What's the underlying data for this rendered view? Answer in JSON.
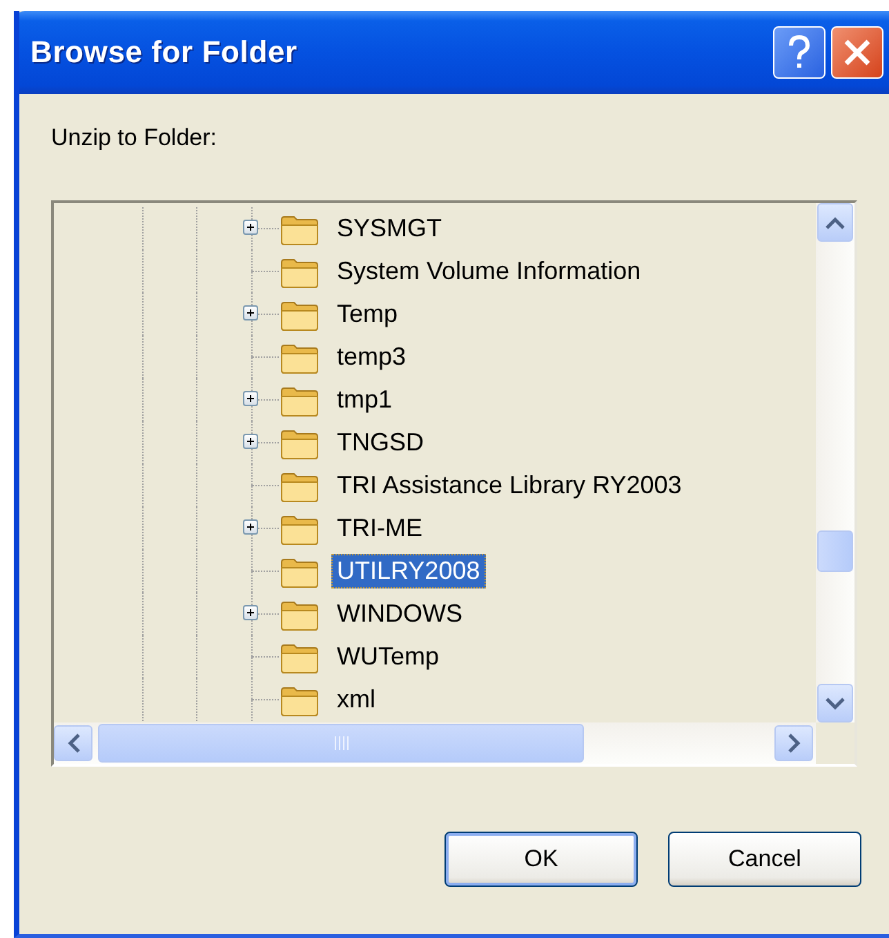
{
  "window": {
    "title": "Browse for Folder"
  },
  "prompt": "Unzip to Folder:",
  "tree": {
    "items": [
      {
        "label": "SYSMGT",
        "has_children": true,
        "selected": false
      },
      {
        "label": "System Volume Information",
        "has_children": false,
        "selected": false
      },
      {
        "label": "Temp",
        "has_children": true,
        "selected": false
      },
      {
        "label": "temp3",
        "has_children": false,
        "selected": false
      },
      {
        "label": "tmp1",
        "has_children": true,
        "selected": false
      },
      {
        "label": "TNGSD",
        "has_children": true,
        "selected": false
      },
      {
        "label": "TRI Assistance Library RY2003",
        "has_children": false,
        "selected": false
      },
      {
        "label": "TRI-ME",
        "has_children": true,
        "selected": false
      },
      {
        "label": "UTILRY2008",
        "has_children": false,
        "selected": true
      },
      {
        "label": "WINDOWS",
        "has_children": true,
        "selected": false
      },
      {
        "label": "WUTemp",
        "has_children": false,
        "selected": false
      },
      {
        "label": "xml",
        "has_children": false,
        "selected": false
      }
    ]
  },
  "buttons": [
    {
      "label": "OK",
      "default": true
    },
    {
      "label": "Cancel",
      "default": false
    }
  ]
}
